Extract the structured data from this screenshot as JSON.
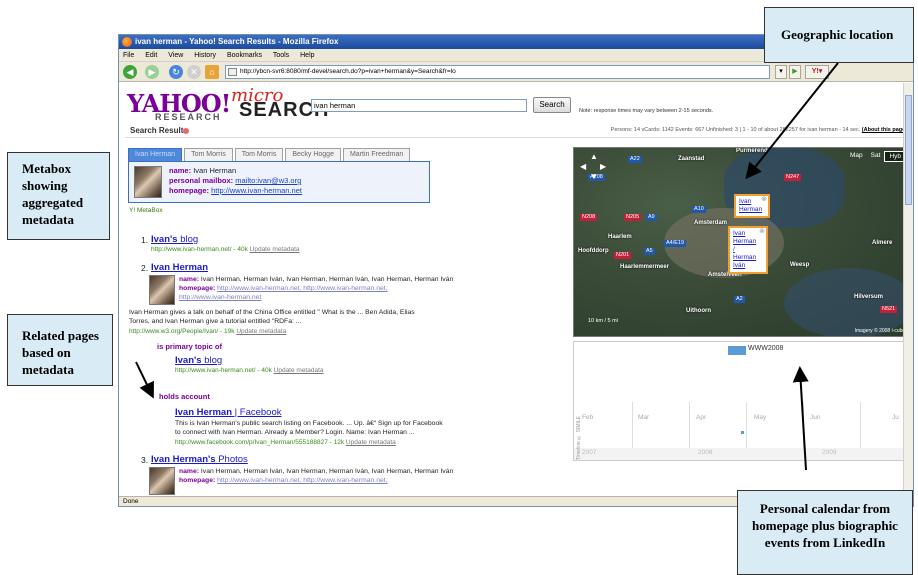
{
  "window": {
    "title": "ivan herman - Yahoo! Search Results - Mozilla Firefox",
    "menu": [
      "File",
      "Edit",
      "View",
      "History",
      "Bookmarks",
      "Tools",
      "Help"
    ],
    "url": "http://ybcn-svr6:8080/mf-devel/search.do?p=ivan+herman&y=Search&fr=lo",
    "status": "Done"
  },
  "header": {
    "logo": "YAHOO!",
    "logo_sub": "RESEARCH",
    "micro": "micro",
    "search_word": "SEARCH",
    "query": "ivan herman",
    "search_button": "Search",
    "note": "Note: response times may vary between 2-15 seconds."
  },
  "results_bar": {
    "title": "Search Results",
    "stats": "Persons: 14 vCards: 1142 Events: 667 Unfinished: 3 | 1 - 10 of about 282257 for ivan herman - 14 sec.",
    "about": "(About this page)"
  },
  "tabs": [
    "Ivan Herman",
    "Tom Morris",
    "Tom Morris",
    "Becky Hogge",
    "Martin Freedman"
  ],
  "metabox": {
    "name_label": "name:",
    "name_value": "Ivan Herman",
    "mailbox_label": "personal mailbox:",
    "mailbox_value": "mailto:ivan@w3.org",
    "homepage_label": "homepage:",
    "homepage_value": "http://www.ivan-herman.net",
    "caption": "Y! MetaBox"
  },
  "results": [
    {
      "num": "1.",
      "title_bold": "Ivan's",
      "title_rest": " blog",
      "url": "http://www.ivan-herman.net/ - 40k",
      "update": "Update metadata"
    },
    {
      "num": "2.",
      "title_bold": "Ivan Herman",
      "name_label": "name:",
      "name_value": "Ivan Herman, Herman Iván, Ivan Herman, Herman Iván, Ivan Herman, Herman Iván",
      "homepage_label": "homepage:",
      "homepage_value": "http://www.ivan-herman.net, http://www.ivan-herman.net,",
      "homepage_value2": "http://www.ivan-herman.net",
      "snippet1": "Ivan Herman gives a talk on behalf of the China Office entitled \" What is the ... Ben Adida, Elias",
      "snippet2": "Torres, and Ivan Herman give a tutorial entitled \"RDFa: ...",
      "url": "http://www.w3.org/People/Ivan/ - 19k",
      "update": "Update metadata",
      "related": [
        {
          "head": "is primary topic of",
          "title_bold": "Ivan's",
          "title_rest": " blog",
          "url": "http://www.ivan-herman.net/ - 40k",
          "update": "Update metadata"
        },
        {
          "head": "holds account",
          "title_bold": "Ivan Herman",
          "title_rest": " | Facebook",
          "snippet1": "This is Ivan Herman's public search listing on Facebook. ... Up. â€“ Sign up for Facebook",
          "snippet2": "to connect with Ivan Herman. Already a Member? Login. Name: Ivan Herman ...",
          "url": "http://www.facebook.com/p/Ivan_Herman/555188827 - 12k",
          "update": "Update metadata"
        }
      ]
    },
    {
      "num": "3.",
      "title_bold": "Ivan Herman's",
      "title_rest": " Photos",
      "name_label": "name:",
      "name_value": "Ivan Herman, Herman Iván, Ivan Herman, Herman Iván, Ivan Herman, Herman Iván",
      "homepage_label": "homepage:",
      "homepage_value": "http://www.ivan-herman.net, http://www.ivan-herman.net,"
    }
  ],
  "map": {
    "controls": [
      "Map",
      "Sat",
      "Hyb"
    ],
    "active_control": "Hyb",
    "places": [
      "Zaanstad",
      "Haarlem",
      "Amsterdam",
      "Hoofddorp",
      "Haarlemmermeer",
      "Amstelveen",
      "Uithoorn",
      "Weesp",
      "Hilversum",
      "Almere",
      "Purmerend"
    ],
    "roads": [
      "A22",
      "A208",
      "N247",
      "N208",
      "N205",
      "A9",
      "A10",
      "A4/E19",
      "N201",
      "A5",
      "A2",
      "N521"
    ],
    "popup1": [
      "Ivan",
      "Herman"
    ],
    "popup2": [
      "Ivan",
      "Herman",
      "/",
      "Herman",
      "Iván"
    ],
    "scale": "10 km / 5 mi",
    "copyright": "Imagery © 2008 i-cubed"
  },
  "timeline": {
    "event": "WWW2008",
    "months": [
      "Feb",
      "Mar",
      "Apr",
      "May",
      "Jun",
      "Ju"
    ],
    "years": [
      "2007",
      "2008",
      "2009"
    ],
    "credit": "Timeline © SIMILE"
  },
  "callouts": {
    "geo": "Geographic location",
    "metabox": "Metabox showing aggregated metadata",
    "related": "Related pages based on metadata",
    "calendar": "Personal calendar from homepage plus biographic events from LinkedIn"
  },
  "colors": {
    "yahoo_purple": "#7b0099",
    "micro_red": "#e0201a",
    "link_blue": "#1a1acd",
    "url_green": "#3a8a1a",
    "callout_bg": "#d9ecf5"
  }
}
